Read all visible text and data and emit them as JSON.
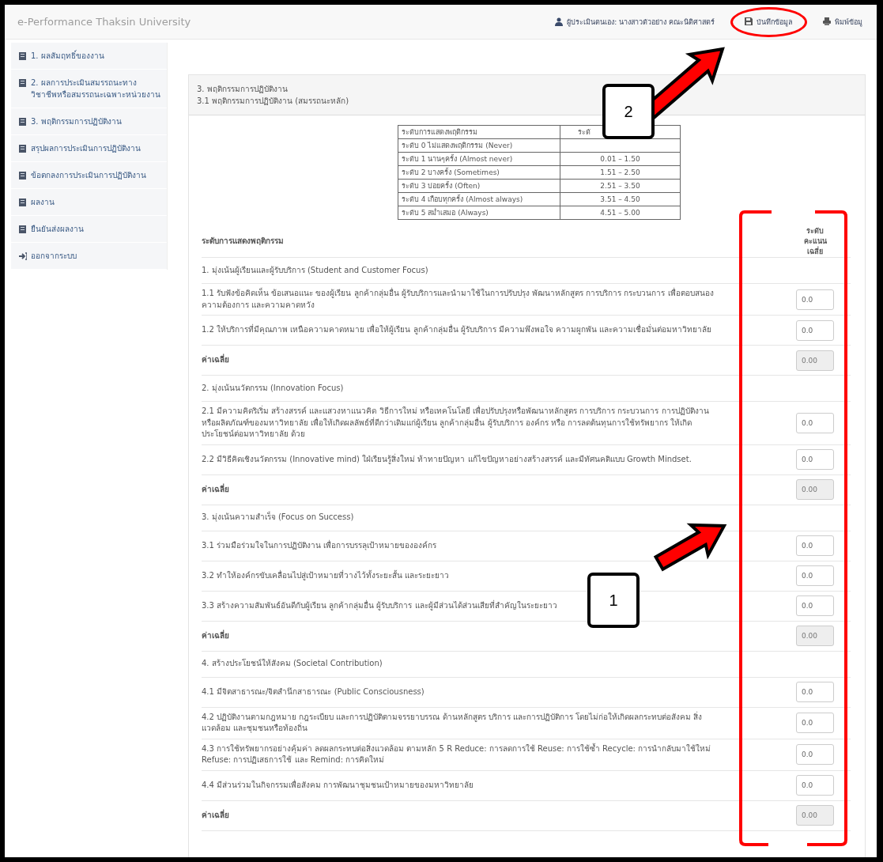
{
  "navbar": {
    "title": "e-Performance Thaksin University",
    "links": [
      {
        "kind": "user",
        "label": "ผู้ประเมินตนเอง: นางสาวตัวอย่าง คณะนิติศาสตร์",
        "highlighted": false
      },
      {
        "kind": "save",
        "label": "บันทึกข้อมูล",
        "highlighted": true
      },
      {
        "kind": "print",
        "label": "พิมพ์ข้อมู",
        "highlighted": false
      }
    ]
  },
  "sidebar": {
    "items": [
      {
        "kind": "doc",
        "label": "1. ผลสัมฤทธิ์ของงาน"
      },
      {
        "kind": "doc",
        "label": "2. ผลการประเมินสมรรถนะทางวิชาชีพหรือสมรรถนะเฉพาะหน่วยงาน"
      },
      {
        "kind": "doc",
        "label": "3. พฤติกรรมการปฏิบัติงาน"
      },
      {
        "kind": "doc",
        "label": "สรุปผลการประเมินการปฏิบัติงาน"
      },
      {
        "kind": "doc",
        "label": "ข้อตกลงการประเมินการปฏิบัติงาน"
      },
      {
        "kind": "doc",
        "label": "ผลงาน"
      },
      {
        "kind": "doc",
        "label": "ยืนยันส่งผลงาน"
      },
      {
        "kind": "logout",
        "label": "ออกจากระบบ"
      }
    ]
  },
  "panel": {
    "heading": [
      "3. พฤติกรรมการปฏิบัติงาน",
      "3.1 พฤติกรรมการปฏิบัติงาน (สมรรถนะหลัก)"
    ],
    "scale_table": {
      "columns": [
        "ระดับการแสดงพฤติกรรม",
        "ระดั"
      ],
      "rows": [
        {
          "level": "ระดับ 0 ไม่แสดงพฤติกรรม (Never)"
        },
        {
          "level": "ระดับ 1 นานๆครั้ง (Almost never)",
          "range": "0.01 – 1.50"
        },
        {
          "level": "ระดับ 2 บางครั้ง (Sometimes)",
          "range": "1.51 – 2.50"
        },
        {
          "level": "ระดับ 3 บ่อยครั้ง (Often)",
          "range": "2.51 – 3.50"
        },
        {
          "level": "ระดับ 4 เกือบทุกครั้ง (Almost always)",
          "range": "3.51 – 4.50"
        },
        {
          "level": "ระดับ 5 สม่ำเสมอ (Always)",
          "range": "4.51 – 5.00"
        }
      ]
    },
    "score_header": {
      "behavior": "ระดับการแสดงพฤติกรรม",
      "score": "ระดับคะแนน เฉลี่ย"
    },
    "groups": [
      {
        "title": "1. มุ่งเน้นผู้เรียนและผู้รับบริการ (Student and Customer Focus)",
        "items": [
          {
            "text": "1.1 รับฟังข้อคิดเห็น ข้อเสนอแนะ ของผู้เรียน ลูกค้ากลุ่มอื่น ผู้รับบริการและนำมาใช้ในการปรับปรุง พัฒนาหลักสูตร การบริการ กระบวนการ เพื่อตอบสนองความต้องการ และความคาดหวัง",
            "value": "0.0"
          },
          {
            "text": "1.2 ให้บริการที่มีคุณภาพ เหนือความคาดหมาย เพื่อให้ผู้เรียน ลูกค้ากลุ่มอื่น ผู้รับบริการ มีความพึงพอใจ ความผูกพัน และความเชื่อมั่นต่อมหาวิทยาลัย",
            "value": "0.0"
          }
        ],
        "average": {
          "label": "ค่าเฉลี่ย",
          "value": "0.00"
        }
      },
      {
        "title": "2. มุ่งเน้นนวัตกรรม (Innovation Focus)",
        "items": [
          {
            "text": "2.1 มีความคิดริเริ่ม สร้างสรรค์ และแสวงหาแนวคิด วิธีการใหม่ หรือเทคโนโลยี เพื่อปรับปรุงหรือพัฒนาหลักสูตร การบริการ กระบวนการ การปฏิบัติงาน หรือผลิตภัณฑ์ของมหาวิทยาลัย เพื่อให้เกิดผลลัพธ์ที่ดีกว่าเดิมแก่ผู้เรียน ลูกค้ากลุ่มอื่น ผู้รับบริการ องค์กร หรือ การลดต้นทุนการใช้ทรัพยากร ให้เกิดประโยชน์ต่อมหาวิทยาลัย ด้วย",
            "value": "0.0"
          },
          {
            "text": "2.2 มีวิธีคิดเชิงนวัตกรรม (Innovative mind) ใฝ่เรียนรู้สิ่งใหม่ ท้าทายปัญหา แก้ไขปัญหาอย่างสร้างสรรค์ และมีทัศนคติแบบ Growth Mindset.",
            "value": "0.0"
          }
        ],
        "average": {
          "label": "ค่าเฉลี่ย",
          "value": "0.00"
        }
      },
      {
        "title": "3. มุ่งเน้นความสำเร็จ (Focus on Success)",
        "items": [
          {
            "text": "3.1 ร่วมมือร่วมใจในการปฏิบัติงาน เพื่อการบรรลุเป้าหมายขององค์กร",
            "value": "0.0"
          },
          {
            "text": "3.2 ทำให้องค์กรขับเคลื่อนไปสู่เป้าหมายที่วางไว้ทั้งระยะสั้น และระยะยาว",
            "value": "0.0"
          },
          {
            "text": "3.3 สร้างความสัมพันธ์อันดีกับผู้เรียน ลูกค้ากลุ่มอื่น ผู้รับบริการ และผู้มีส่วนได้ส่วนเสียที่สำคัญในระยะยาว",
            "value": "0.0"
          }
        ],
        "average": {
          "label": "ค่าเฉลี่ย",
          "value": "0.00"
        }
      },
      {
        "title": "4. สร้างประโยชน์ให้สังคม (Societal Contribution)",
        "items": [
          {
            "text": "4.1 มีจิตสาธารณะ/จิตสำนึกสาธารณะ (Public Consciousness)",
            "value": "0.0"
          },
          {
            "text": "4.2 ปฏิบัติงานตามกฎหมาย กฎระเบียบ และการปฏิบัติตามจรรยาบรรณ ด้านหลักสูตร บริการ และการปฏิบัติการ โดยไม่ก่อให้เกิดผลกระทบต่อสังคม สิ่งแวดล้อม และชุมชนหรือท้องถิ่น",
            "value": "0.0"
          },
          {
            "text": "4.3 การใช้ทรัพยากรอย่างคุ้มค่า ลดผลกระทบต่อสิ่งแวดล้อม ตามหลัก 5 R Reduce: การลดการใช้ Reuse: การใช้ซ้ำ Recycle: การนำกลับมาใช้ใหม่ Refuse: การปฏิเสธการใช้ และ Remind: การคิดใหม่",
            "value": "0.0"
          },
          {
            "text": "4.4 มีส่วนร่วมในกิจกรรมเพื่อสังคม การพัฒนาชุมชนเป้าหมายของมหาวิทยาลัย",
            "value": "0.0"
          }
        ],
        "average": {
          "label": "ค่าเฉลี่ย",
          "value": "0.00"
        }
      }
    ]
  },
  "annotations": {
    "callouts": [
      {
        "label": "2"
      },
      {
        "label": "1"
      }
    ]
  }
}
